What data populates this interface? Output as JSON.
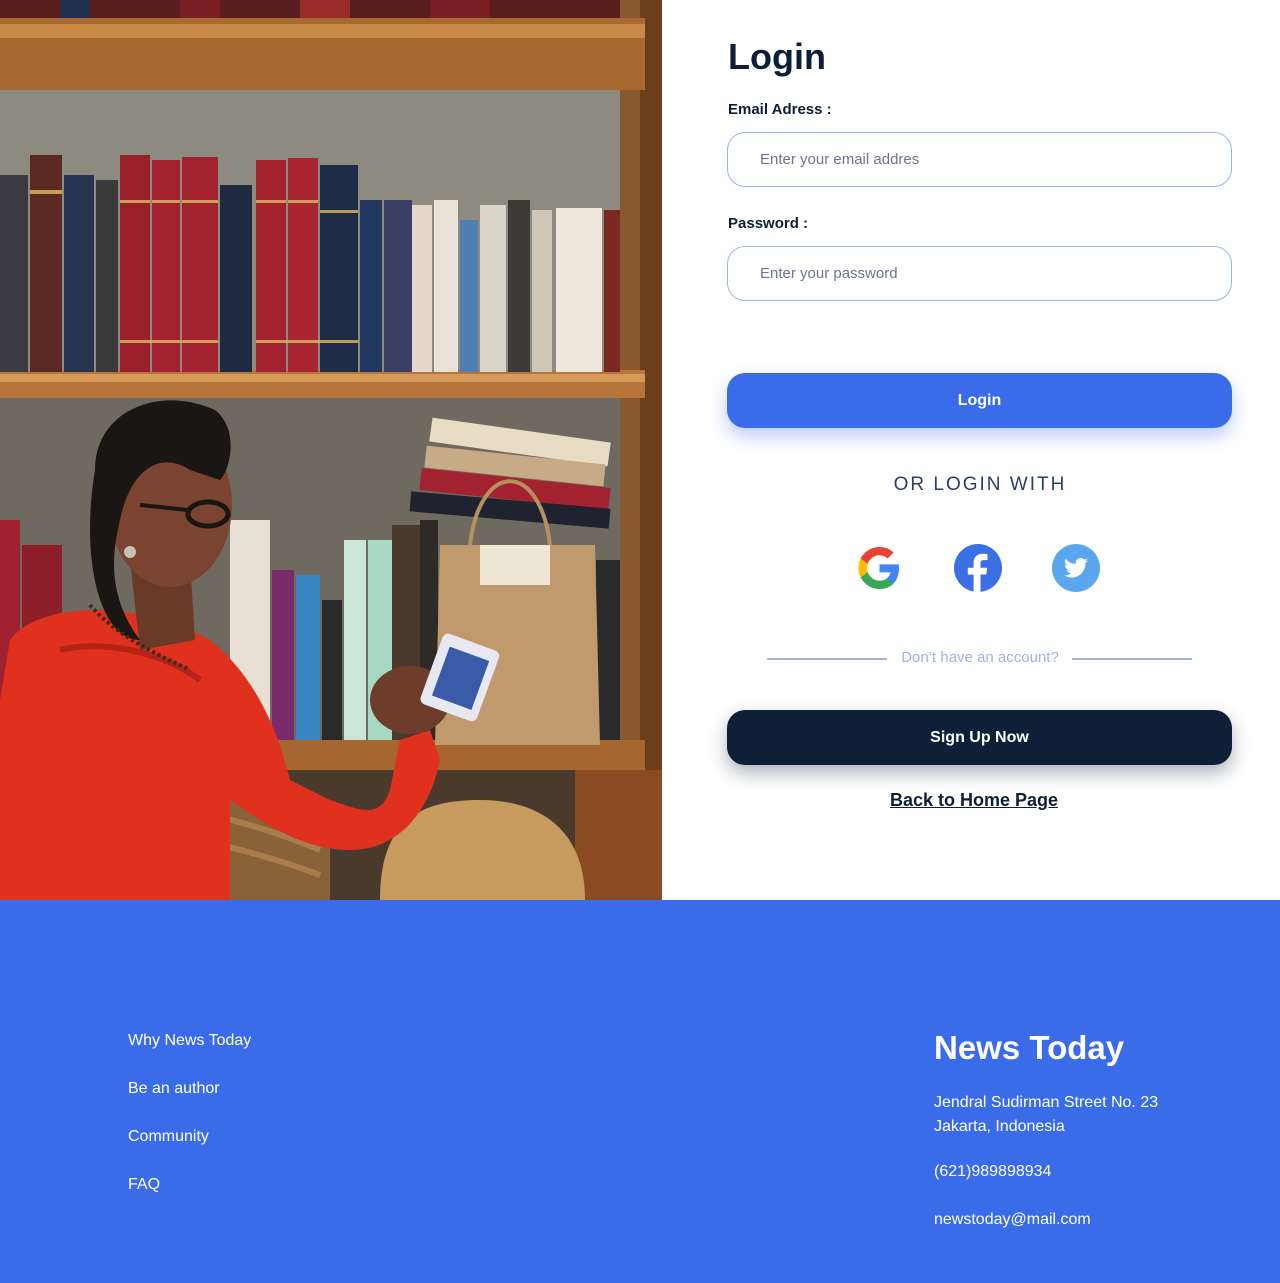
{
  "login": {
    "title": "Login",
    "email_label": "Email Adress :",
    "email_placeholder": "Enter your email addres",
    "email_value": "",
    "password_label": "Password :",
    "password_placeholder": "Enter your password",
    "password_value": "",
    "login_button": "Login",
    "or_text": "OR LOGIN WITH",
    "social": [
      "google-icon",
      "facebook-icon",
      "twitter-icon"
    ],
    "no_account_text": "Don’t have an account?",
    "signup_button": "Sign Up Now",
    "back_link": "Back to Home Page"
  },
  "footer": {
    "links": [
      "Why News Today",
      "Be an author",
      "Community",
      "FAQ"
    ],
    "brand": "News Today",
    "address_line1": "Jendral Sudirman Street No. 23",
    "address_line2": "Jakarta, Indonesia",
    "phone": "(621)989898934",
    "email": "newstoday@mail.com"
  },
  "colors": {
    "primary": "#3a6be8",
    "dark": "#0d2038",
    "field_border": "#9fb3e8",
    "google_red": "#ea4335",
    "google_yellow": "#fbbc05",
    "google_green": "#34a853",
    "google_blue": "#4285f4",
    "facebook": "#3b6fe6",
    "twitter": "#5aa7ef"
  }
}
